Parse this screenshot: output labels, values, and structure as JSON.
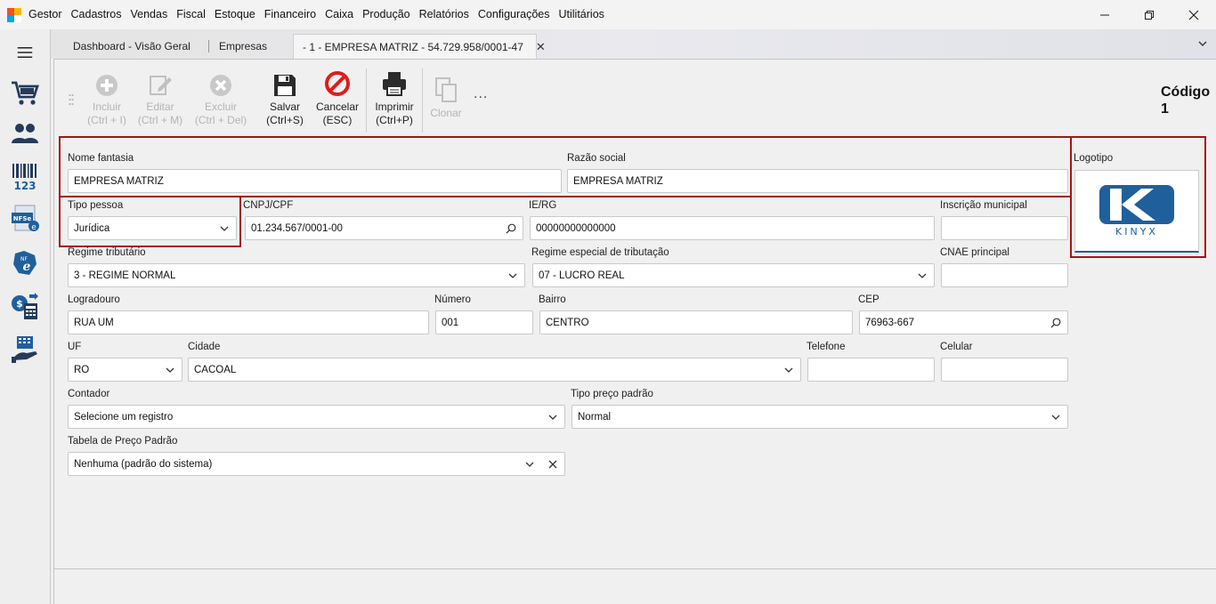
{
  "menu": [
    "Gestor",
    "Cadastros",
    "Vendas",
    "Fiscal",
    "Estoque",
    "Financeiro",
    "Caixa",
    "Produção",
    "Relatórios",
    "Configurações",
    "Utilitários"
  ],
  "sidebar": [
    {
      "icon": "cart-icon"
    },
    {
      "icon": "users-icon"
    },
    {
      "icon": "barcode-icon",
      "text": "123"
    },
    {
      "icon": "nfse-icon",
      "text": "NFSe"
    },
    {
      "icon": "nfe-icon",
      "text": "NFe"
    },
    {
      "icon": "finance-icon"
    },
    {
      "icon": "cashier-icon"
    }
  ],
  "tabs": [
    {
      "label": "Dashboard - Visão Geral"
    },
    {
      "label": "Empresas"
    },
    {
      "label": "- 1 - EMPRESA MATRIZ - 54.729.958/0001-47",
      "close": "✕"
    }
  ],
  "toolbar": {
    "incluir": {
      "label": "Incluir",
      "shortcut": "(Ctrl + I)"
    },
    "editar": {
      "label": "Editar",
      "shortcut": "(Ctrl + M)"
    },
    "excluir": {
      "label": "Excluir",
      "shortcut": "(Ctrl + Del)"
    },
    "salvar": {
      "label": "Salvar",
      "shortcut": "(Ctrl+S)"
    },
    "cancelar": {
      "label": "Cancelar",
      "shortcut": "(ESC)"
    },
    "imprimir": {
      "label": "Imprimir",
      "shortcut": "(Ctrl+P)"
    },
    "clonar": {
      "label": "Clonar"
    },
    "more": "..."
  },
  "codigo": {
    "label": "Código",
    "value": "1"
  },
  "form": {
    "nome_fantasia": {
      "label": "Nome fantasia",
      "value": "EMPRESA MATRIZ"
    },
    "razao_social": {
      "label": "Razão social",
      "value": "EMPRESA MATRIZ"
    },
    "logotipo": {
      "label": "Logotipo",
      "logo_text": "KINYX"
    },
    "tipo_pessoa": {
      "label": "Tipo pessoa",
      "value": "Jurídica"
    },
    "cnpj_cpf": {
      "label": "CNPJ/CPF",
      "value": "01.234.567/0001-00"
    },
    "ie_rg": {
      "label": "IE/RG",
      "value": "00000000000000"
    },
    "inscricao_municipal": {
      "label": "Inscrição municipal",
      "value": ""
    },
    "regime_tributario": {
      "label": "Regime tributário",
      "value": "3 - REGIME NORMAL"
    },
    "regime_especial": {
      "label": "Regime especial de tributação",
      "value": "07 - LUCRO REAL"
    },
    "cnae": {
      "label": "CNAE principal",
      "value": ""
    },
    "logradouro": {
      "label": "Logradouro",
      "value": "RUA UM"
    },
    "numero": {
      "label": "Número",
      "value": "001"
    },
    "bairro": {
      "label": "Bairro",
      "value": "CENTRO"
    },
    "cep": {
      "label": "CEP",
      "value": "76963-667"
    },
    "uf": {
      "label": "UF",
      "value": "RO"
    },
    "cidade": {
      "label": "Cidade",
      "value": "CACOAL"
    },
    "telefone": {
      "label": "Telefone",
      "value": ""
    },
    "celular": {
      "label": "Celular",
      "value": ""
    },
    "contador": {
      "label": "Contador",
      "value": "Selecione um registro"
    },
    "tipo_preco": {
      "label": "Tipo preço padrão",
      "value": "Normal"
    },
    "tabela_preco": {
      "label": "Tabela de Preço Padrão",
      "value": "Nenhuma (padrão do sistema)"
    }
  },
  "colors": {
    "highlight": "#a31515",
    "logo_blue": "#1f5f9c"
  }
}
